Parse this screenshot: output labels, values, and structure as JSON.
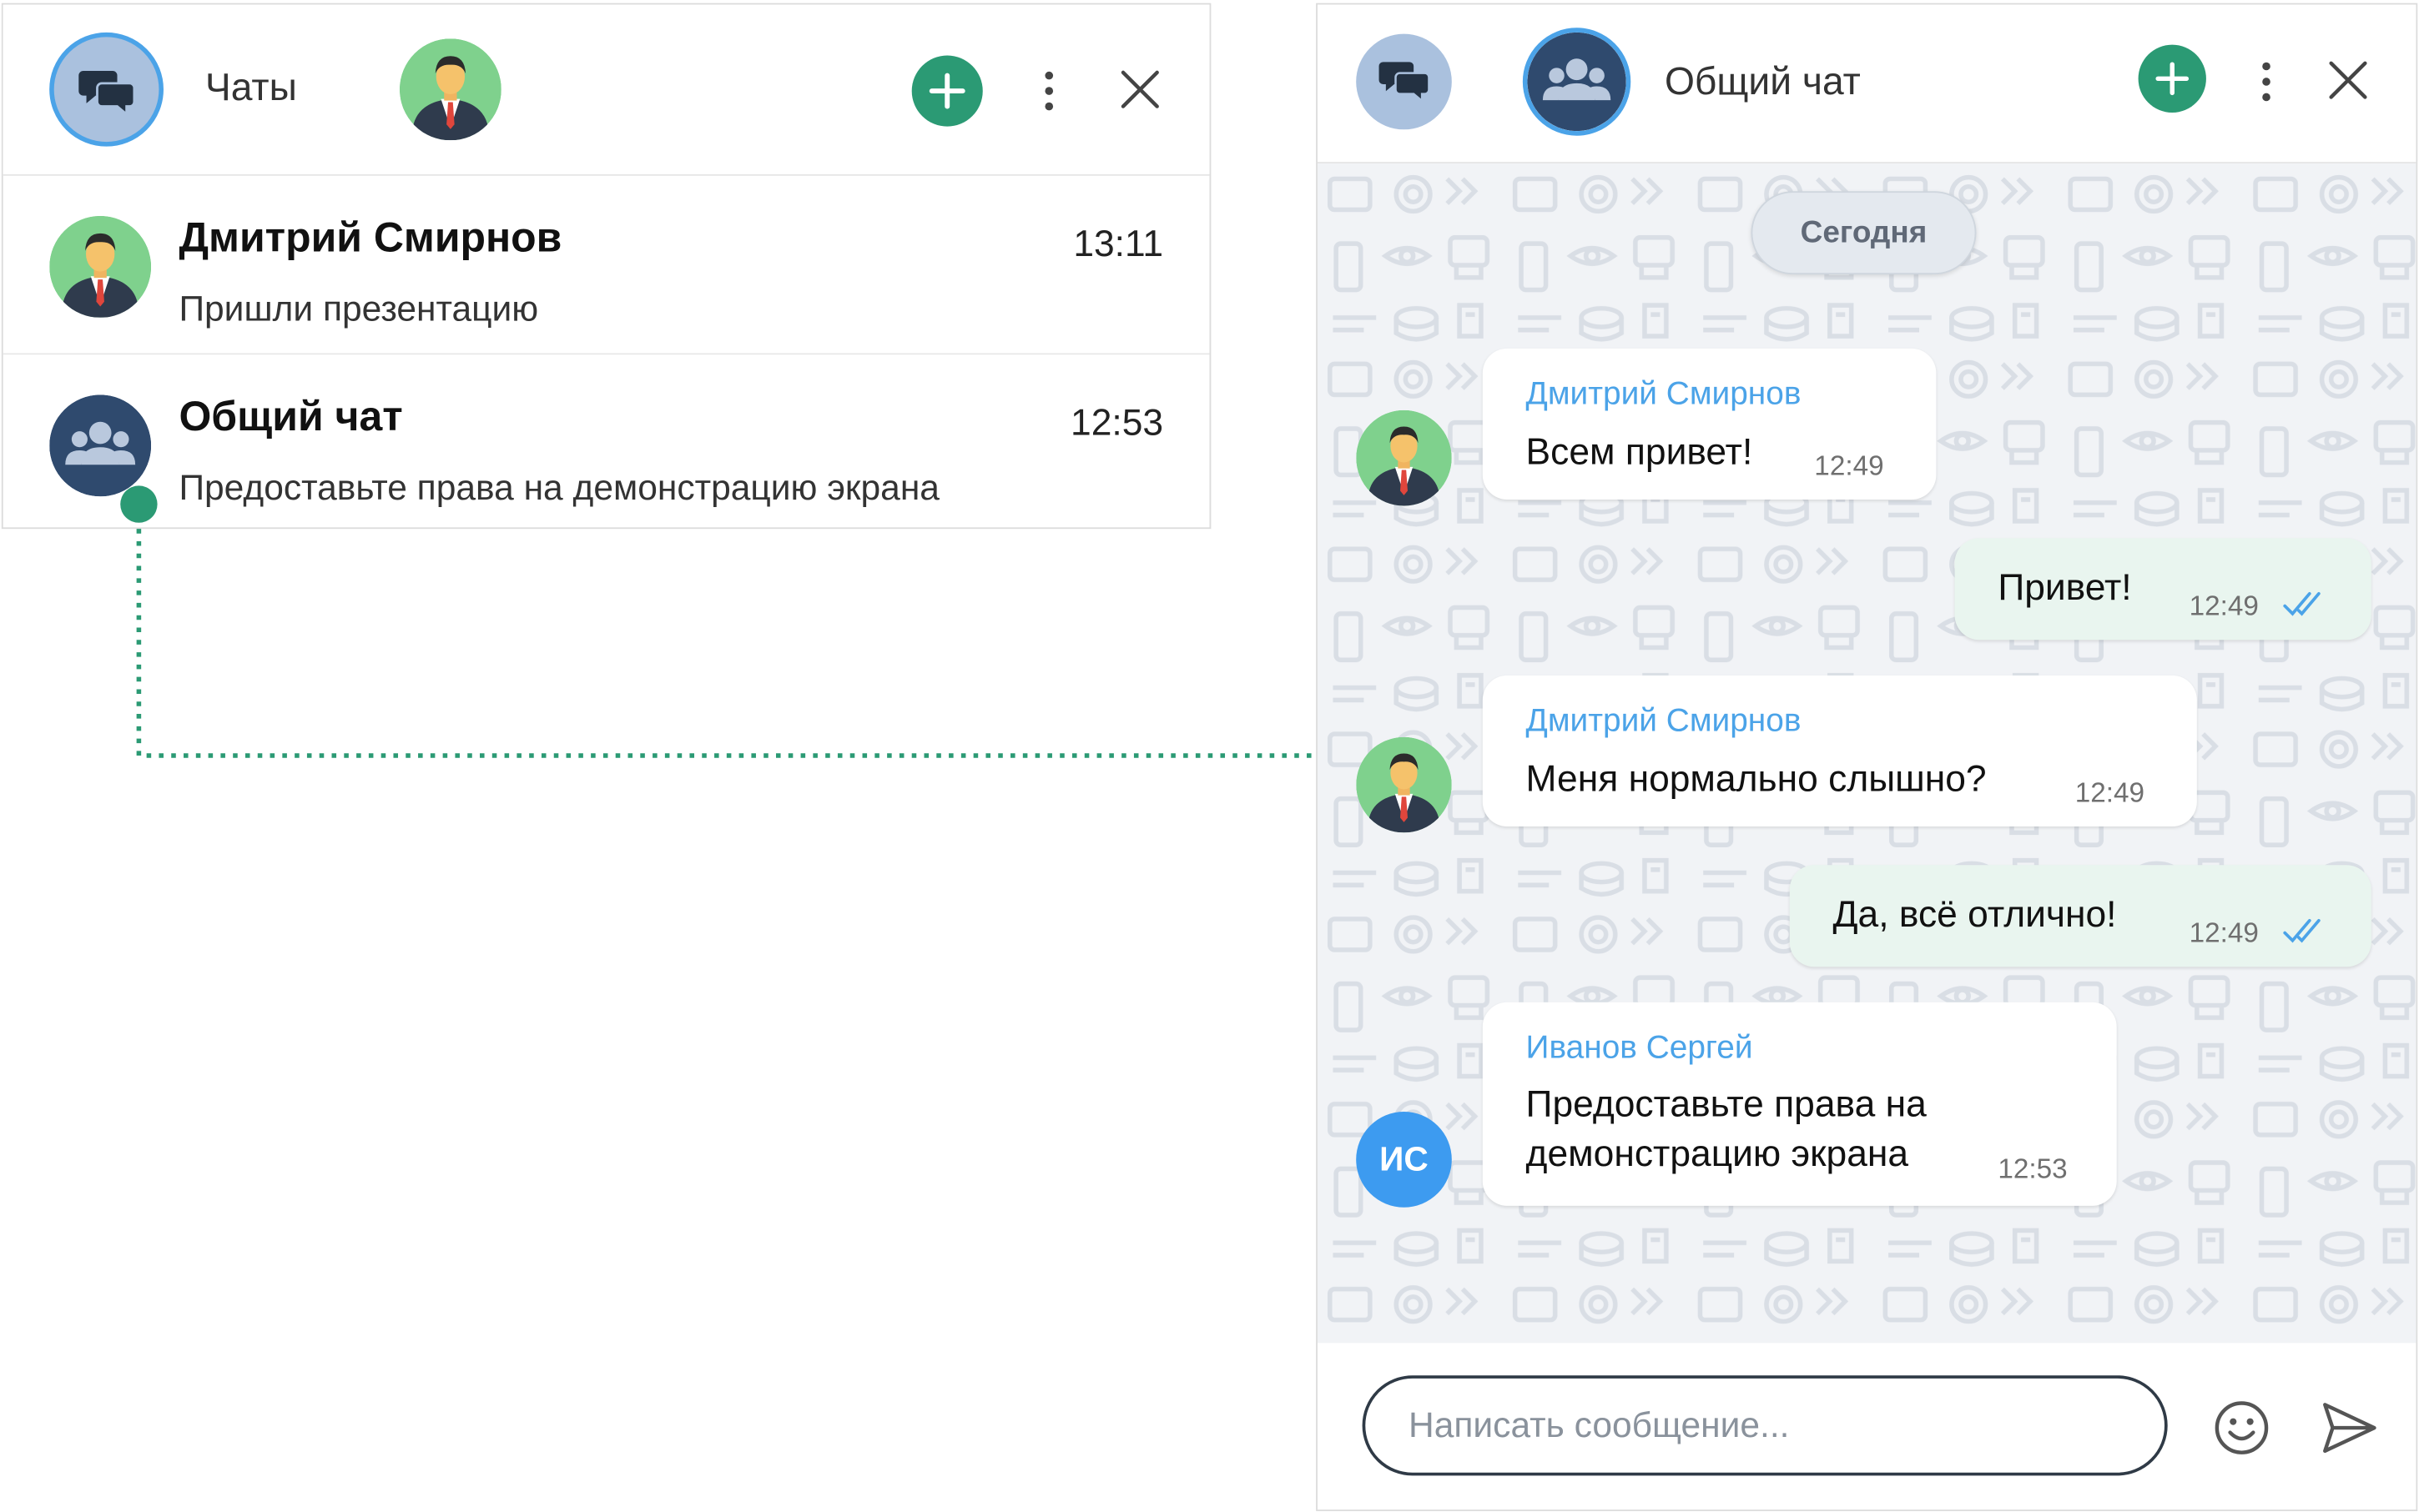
{
  "chat_list": {
    "title": "Чаты",
    "items": [
      {
        "name": "Дмитрий Смирнов",
        "time": "13:11",
        "preview": "Пришли презентацию"
      },
      {
        "name": "Общий чат",
        "time": "12:53",
        "preview": "Предоставьте права на демонстрацию экрана"
      }
    ]
  },
  "chat": {
    "title": "Общий чат",
    "date_label": "Сегодня",
    "messages": [
      {
        "direction": "in",
        "sender": "Дмитрий Смирнов",
        "lines": [
          "Всем привет!"
        ],
        "time": "12:49"
      },
      {
        "direction": "out",
        "lines": [
          "Привет!"
        ],
        "time": "12:49",
        "read": true
      },
      {
        "direction": "in",
        "sender": "Дмитрий Смирнов",
        "lines": [
          "Меня нормально слышно?"
        ],
        "time": "12:49"
      },
      {
        "direction": "out",
        "lines": [
          "Да, всё отлично!"
        ],
        "time": "12:49",
        "read": true
      },
      {
        "direction": "in",
        "sender": "Иванов Сергей",
        "avatar_initials": "ИС",
        "lines": [
          "Предоставьте права на",
          "демонстрацию экрана"
        ],
        "time": "12:53"
      }
    ],
    "input_placeholder": "Написать сообщение..."
  },
  "icons": {
    "chats_logo": "chat-bubbles-icon",
    "group_avatar": "group-people-icon",
    "new_chat": "plus-icon",
    "menu": "more-vertical-icon",
    "close": "close-icon",
    "emoji": "smile-icon",
    "send": "send-icon",
    "read_receipt": "double-check-icon"
  },
  "colors": {
    "accent_green": "#2b9a74",
    "sender_blue": "#4ba3e8",
    "group_avatar": "#2f4a6e",
    "initials_avatar": "#3d9bf0",
    "outgoing_bubble": "#e9f5ef",
    "chat_background": "#f1f3f6"
  }
}
